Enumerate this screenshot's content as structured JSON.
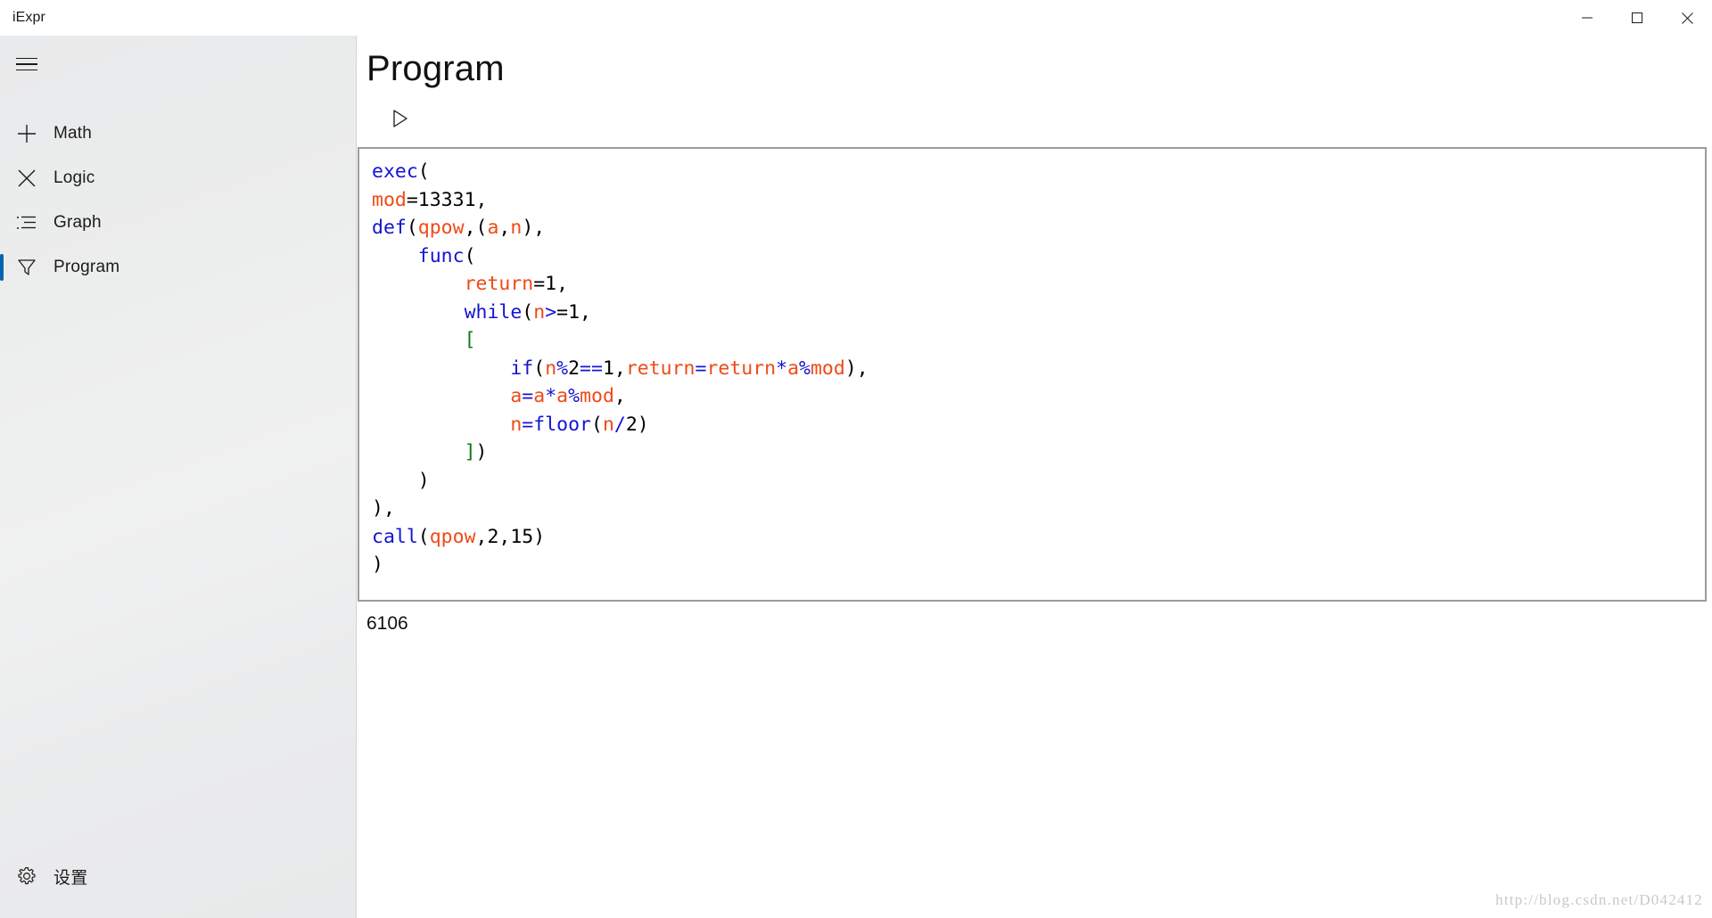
{
  "window": {
    "title": "iExpr",
    "controls": [
      {
        "name": "minimize",
        "glyph": "minimize-icon"
      },
      {
        "name": "maximize",
        "glyph": "maximize-icon"
      },
      {
        "name": "close",
        "glyph": "close-icon"
      }
    ]
  },
  "sidebar": {
    "menu_icon": "hamburger-icon",
    "items": [
      {
        "label": "Math",
        "icon": "plus-icon",
        "active": false
      },
      {
        "label": "Logic",
        "icon": "cross-icon",
        "active": false
      },
      {
        "label": "Graph",
        "icon": "list-icon",
        "active": false
      },
      {
        "label": "Program",
        "icon": "funnel-icon",
        "active": true
      }
    ],
    "settings": {
      "label": "设置",
      "icon": "gear-icon"
    }
  },
  "main": {
    "page_title": "Program",
    "run_button": {
      "label": "Run",
      "icon": "play-icon"
    },
    "editor": {
      "lines": [
        [
          {
            "t": "exec",
            "c": "k"
          },
          {
            "t": "(",
            "c": "pl"
          }
        ],
        [
          {
            "t": "mod",
            "c": "id"
          },
          {
            "t": "=13331,",
            "c": "pl"
          }
        ],
        [
          {
            "t": "def",
            "c": "k"
          },
          {
            "t": "(",
            "c": "pl"
          },
          {
            "t": "qpow",
            "c": "id"
          },
          {
            "t": ",(",
            "c": "pl"
          },
          {
            "t": "a",
            "c": "id"
          },
          {
            "t": ",",
            "c": "pl"
          },
          {
            "t": "n",
            "c": "id"
          },
          {
            "t": "),",
            "c": "pl"
          }
        ],
        [
          {
            "t": "    ",
            "c": "pl"
          },
          {
            "t": "func",
            "c": "k"
          },
          {
            "t": "(",
            "c": "pl"
          }
        ],
        [
          {
            "t": "        ",
            "c": "pl"
          },
          {
            "t": "return",
            "c": "id"
          },
          {
            "t": "=1,",
            "c": "pl"
          }
        ],
        [
          {
            "t": "        ",
            "c": "pl"
          },
          {
            "t": "while",
            "c": "k"
          },
          {
            "t": "(",
            "c": "pl"
          },
          {
            "t": "n",
            "c": "id"
          },
          {
            "t": ">",
            "c": "op"
          },
          {
            "t": "=1,",
            "c": "pl"
          }
        ],
        [
          {
            "t": "        ",
            "c": "pl"
          },
          {
            "t": "[",
            "c": "br"
          }
        ],
        [
          {
            "t": "            ",
            "c": "pl"
          },
          {
            "t": "if",
            "c": "k"
          },
          {
            "t": "(",
            "c": "pl"
          },
          {
            "t": "n",
            "c": "id"
          },
          {
            "t": "%",
            "c": "op"
          },
          {
            "t": "2",
            "c": "pl"
          },
          {
            "t": "==",
            "c": "op"
          },
          {
            "t": "1,",
            "c": "pl"
          },
          {
            "t": "return",
            "c": "id"
          },
          {
            "t": "=",
            "c": "op"
          },
          {
            "t": "return",
            "c": "id"
          },
          {
            "t": "*",
            "c": "op"
          },
          {
            "t": "a",
            "c": "id"
          },
          {
            "t": "%",
            "c": "op"
          },
          {
            "t": "mod",
            "c": "id"
          },
          {
            "t": "),",
            "c": "pl"
          }
        ],
        [
          {
            "t": "            ",
            "c": "pl"
          },
          {
            "t": "a",
            "c": "id"
          },
          {
            "t": "=",
            "c": "op"
          },
          {
            "t": "a",
            "c": "id"
          },
          {
            "t": "*",
            "c": "op"
          },
          {
            "t": "a",
            "c": "id"
          },
          {
            "t": "%",
            "c": "op"
          },
          {
            "t": "mod",
            "c": "id"
          },
          {
            "t": ",",
            "c": "pl"
          }
        ],
        [
          {
            "t": "            ",
            "c": "pl"
          },
          {
            "t": "n",
            "c": "id"
          },
          {
            "t": "=",
            "c": "op"
          },
          {
            "t": "floor",
            "c": "k"
          },
          {
            "t": "(",
            "c": "pl"
          },
          {
            "t": "n",
            "c": "id"
          },
          {
            "t": "/",
            "c": "op"
          },
          {
            "t": "2)",
            "c": "pl"
          }
        ],
        [
          {
            "t": "        ",
            "c": "pl"
          },
          {
            "t": "]",
            "c": "br"
          },
          {
            "t": ")",
            "c": "pl"
          }
        ],
        [
          {
            "t": "    )",
            "c": "pl"
          }
        ],
        [
          {
            "t": "),",
            "c": "pl"
          }
        ],
        [
          {
            "t": "call",
            "c": "k"
          },
          {
            "t": "(",
            "c": "pl"
          },
          {
            "t": "qpow",
            "c": "id"
          },
          {
            "t": ",2,15)",
            "c": "pl"
          }
        ],
        [
          {
            "t": ")",
            "c": "pl"
          }
        ]
      ],
      "plain_text": "exec(\nmod=13331,\ndef(qpow,(a,n),\n    func(\n        return=1,\n        while(n>=1,\n        [\n            if(n%2==1,return=return*a%mod),\n            a=a*a%mod,\n            n=floor(n/2)\n        ])\n    )\n),\ncall(qpow,2,15)\n)"
    },
    "result": "6106"
  },
  "watermark": "http://blog.csdn.net/D042412",
  "colors": {
    "keyword": "#1414d4",
    "identifier": "#f04a16",
    "operator": "#1414d4",
    "bracket": "#0a7a12",
    "plain": "#000000",
    "accent": "#0a63b0",
    "sidebar_bg": "#ecedee",
    "editor_border": "#9b9b9b"
  }
}
